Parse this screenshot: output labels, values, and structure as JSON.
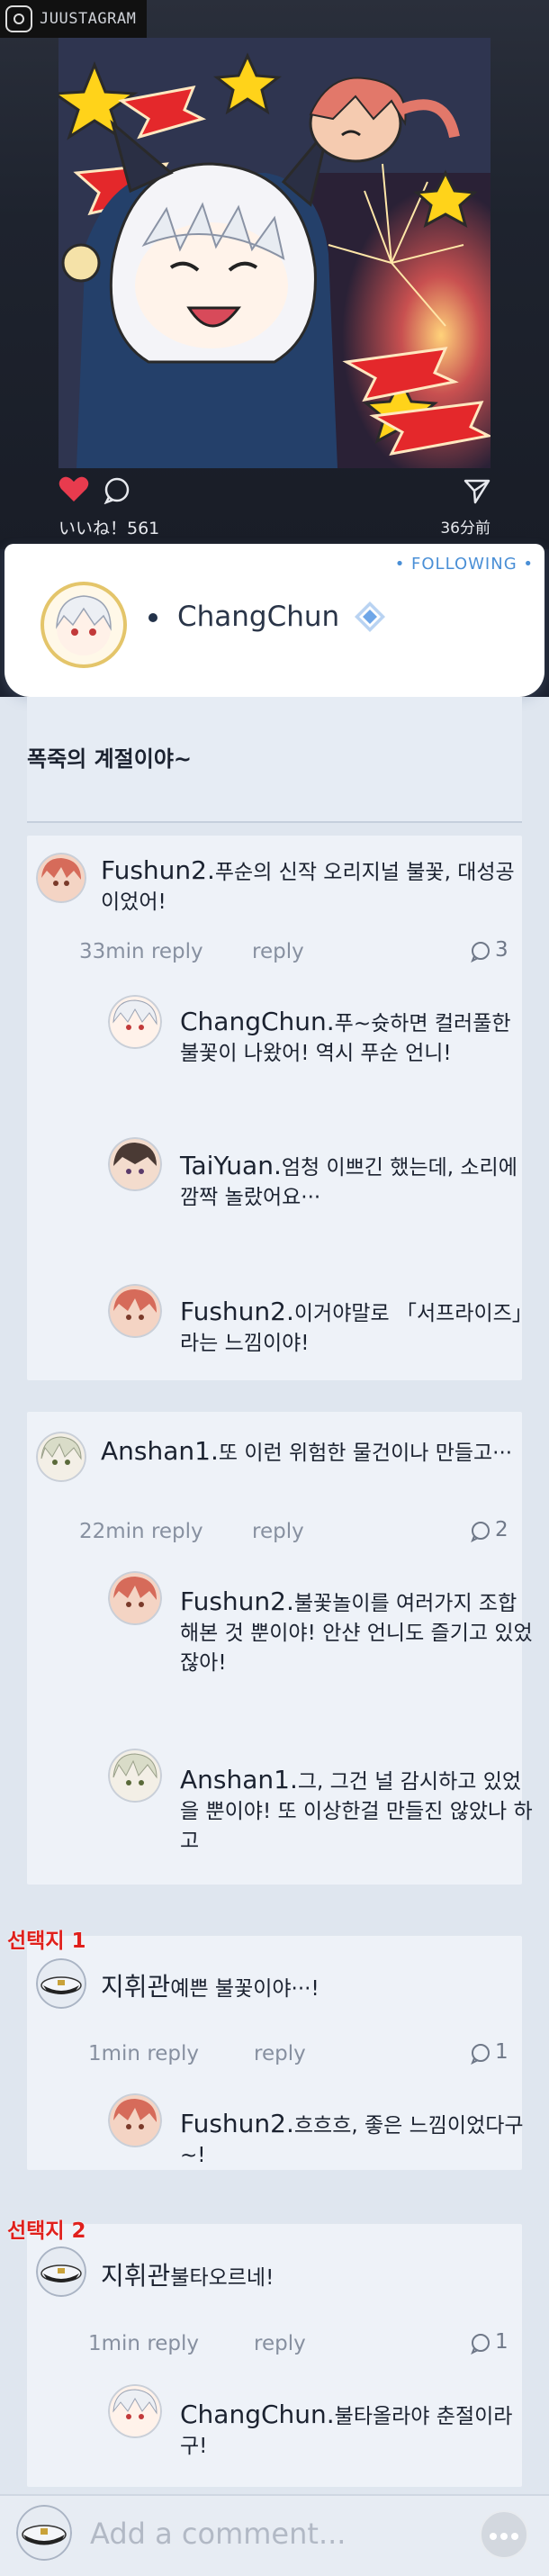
{
  "app": {
    "name": "JUUSTAGRAM"
  },
  "post": {
    "likes_text": "いいね！561",
    "time_text": "36分前",
    "caption": "폭죽의 계절이야~"
  },
  "profile": {
    "following": "• FOLLOWING •",
    "bullet": "•",
    "name": "ChangChun"
  },
  "threads": [
    {
      "author": "Fushun2.",
      "text": "푸순의 신작 오리지널 불꽃, 대성공이었어!",
      "time": "33min reply",
      "reply": "reply",
      "count": "3",
      "replies": [
        {
          "author": "ChangChun.",
          "text": "푸~슛하면 컬러풀한 불꽃이 나왔어! 역시 푸순 언니!"
        },
        {
          "author": "TaiYuan.",
          "text": "엄청 이쁘긴 했는데, 소리에 깜짝 놀랐어요···"
        },
        {
          "author": "Fushun2.",
          "text": "이거야말로 「서프라이즈」라는 느낌이야!"
        }
      ]
    },
    {
      "author": "Anshan1.",
      "text": "또 이런 위험한 물건이나 만들고···",
      "time": "22min reply",
      "reply": "reply",
      "count": "2",
      "replies": [
        {
          "author": "Fushun2.",
          "text": "불꽃놀이를 여러가지 조합해본 것 뿐이야! 안샨 언니도 즐기고 있었잖아!"
        },
        {
          "author": "Anshan1.",
          "text": "그, 그건 널 감시하고 있었을 뿐이야! 또 이상한걸 만들진 않았나 하고"
        }
      ]
    }
  ],
  "choices": [
    {
      "label": "선택지 1",
      "author": "지휘관",
      "text": "예쁜 불꽃이야···!",
      "time": "1min reply",
      "reply": "reply",
      "count": "1",
      "reply_item": {
        "author": "Fushun2.",
        "text": "흐흐흐, 좋은 느낌이었다구~!"
      }
    },
    {
      "label": "선택지 2",
      "author": "지휘관",
      "text": "불타오르네!",
      "time": "1min reply",
      "reply": "reply",
      "count": "1",
      "reply_item": {
        "author": "ChangChun.",
        "text": "불타올라야 춘절이라구!"
      }
    }
  ],
  "composer": {
    "placeholder": "Add a comment..."
  },
  "icons": {
    "heart": "heart-icon",
    "comment": "comment-bubble-icon",
    "share": "send-icon",
    "verified": "verified-badge-icon",
    "more": "more-dots-icon"
  },
  "colors": {
    "heart": "#e83b4e",
    "following": "#4a8fd6",
    "choice_label": "#e0201c",
    "verified": "#6ea6e8"
  }
}
